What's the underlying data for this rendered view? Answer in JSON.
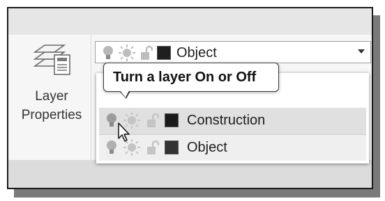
{
  "panel": {
    "layer_properties_label_line1": "Layer",
    "layer_properties_label_line2": "Properties"
  },
  "combo": {
    "selected_layer": "Object"
  },
  "tooltip": {
    "text": "Turn a layer On or Off"
  },
  "dropdown": {
    "items": [
      {
        "name": "Construction",
        "color": "#1a1a1a",
        "state": "hover"
      },
      {
        "name": "Object",
        "color": "#333333",
        "state": "normal"
      }
    ]
  },
  "icons": {
    "layer_properties": "layer-stack-icon",
    "on_off": "lightbulb-icon",
    "freeze": "sun-icon",
    "lock": "padlock-open-icon",
    "dropdown_arrow": "chevron-down-icon",
    "pointer": "mouse-pointer-icon"
  }
}
